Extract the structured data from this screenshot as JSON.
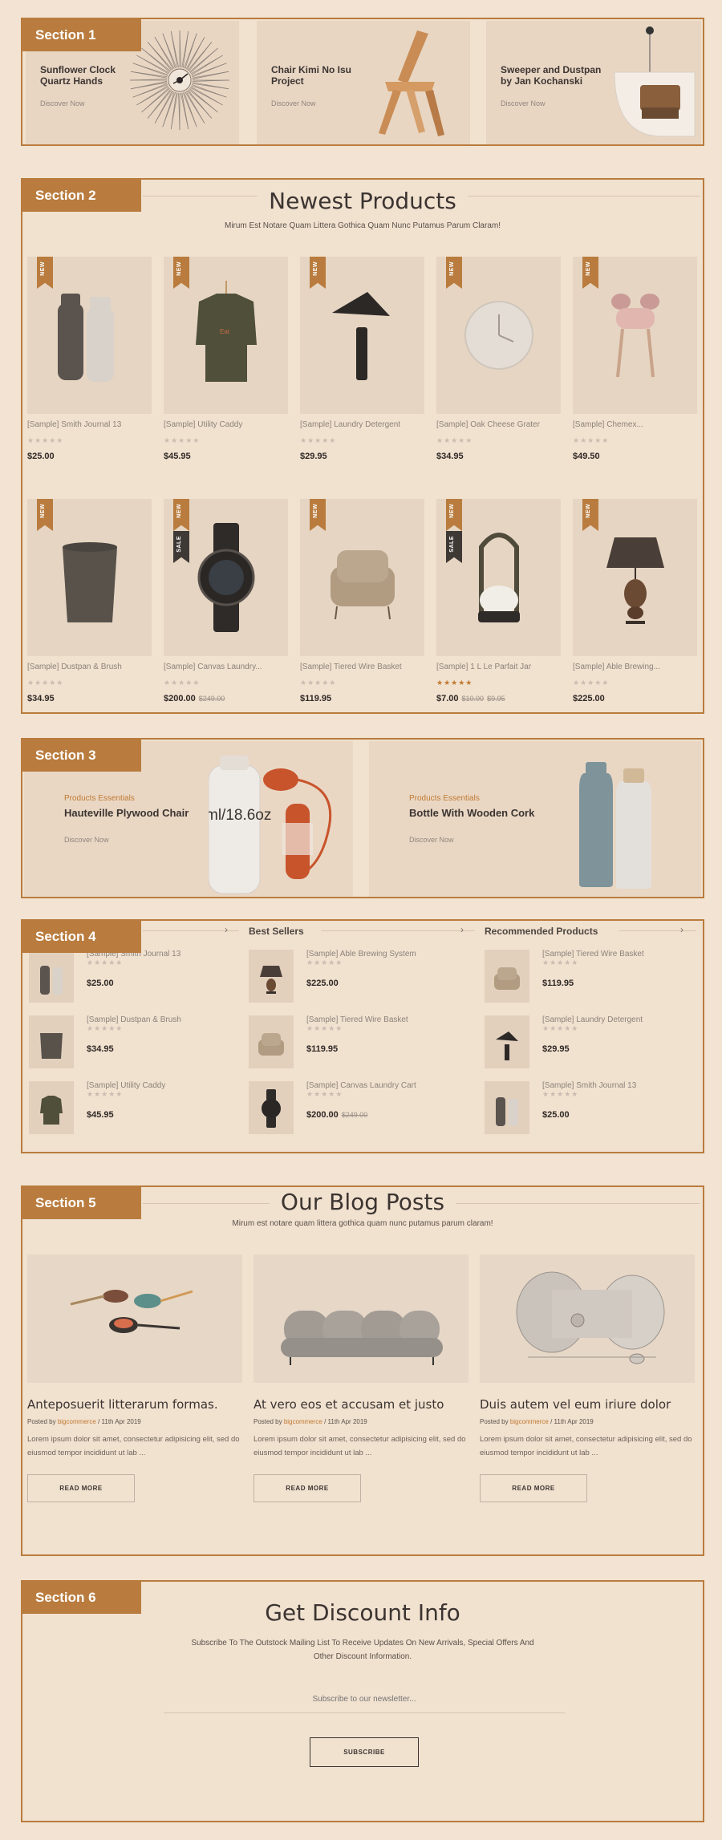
{
  "sections": [
    "Section 1",
    "Section 2",
    "Section 3",
    "Section 4",
    "Section 5",
    "Section 6"
  ],
  "s1": {
    "cards": [
      {
        "title": "Sunflower Clock Quartz Hands",
        "cta": "Discover Now"
      },
      {
        "title": "Chair Kimi No Isu Project",
        "cta": "Discover Now"
      },
      {
        "title": "Sweeper and Dustpan by Jan Kochanski",
        "cta": "Discover Now"
      }
    ]
  },
  "s2": {
    "heading": "Newest Products",
    "subheading": "Mirum Est Notare Quam Littera Gothica Quam Nunc Putamus Parum Claram!",
    "badge_new": "NEW",
    "badge_sale": "SALE",
    "products": [
      {
        "name": "[Sample] Smith Journal 13",
        "stars": "★★★★★",
        "price": "$25.00",
        "old": "",
        "old2": ""
      },
      {
        "name": "[Sample] Utility Caddy",
        "stars": "★★★★★",
        "price": "$45.95",
        "old": "",
        "old2": ""
      },
      {
        "name": "[Sample] Laundry Detergent",
        "stars": "★★★★★",
        "price": "$29.95",
        "old": "",
        "old2": ""
      },
      {
        "name": "[Sample] Oak Cheese Grater",
        "stars": "★★★★★",
        "price": "$34.95",
        "old": "",
        "old2": ""
      },
      {
        "name": "[Sample] Chemex...",
        "stars": "★★★★★",
        "price": "$49.50",
        "old": "",
        "old2": ""
      },
      {
        "name": "[Sample] Dustpan & Brush",
        "stars": "★★★★★",
        "price": "$34.95",
        "old": "",
        "old2": ""
      },
      {
        "name": "[Sample] Canvas Laundry...",
        "stars": "★★★★★",
        "price": "$200.00",
        "old": "$249.00",
        "old2": ""
      },
      {
        "name": "[Sample] Tiered Wire Basket",
        "stars": "★★★★★",
        "price": "$119.95",
        "old": "",
        "old2": ""
      },
      {
        "name": "[Sample] 1 L Le Parfait Jar",
        "stars": "★★★★★",
        "price": "$7.00",
        "old": "$10.00",
        "old2": "$9.95"
      },
      {
        "name": "[Sample] Able Brewing...",
        "stars": "★★★★★",
        "price": "$225.00",
        "old": "",
        "old2": ""
      }
    ]
  },
  "s3": {
    "cards": [
      {
        "kicker": "Products Essentials",
        "title": "Hauteville Plywood Chair",
        "cta": "Discover Now",
        "bottle_text": "ml/18.6oz"
      },
      {
        "kicker": "Products Essentials",
        "title": "Bottle With Wooden Cork",
        "cta": "Discover Now"
      }
    ]
  },
  "s4": {
    "col2_title": "Best Sellers",
    "col3_title": "Recommended Products",
    "arrow": "›",
    "col1": [
      {
        "name": "[Sample] Smith Journal 13",
        "stars": "★★★★★",
        "price": "$25.00",
        "old": ""
      },
      {
        "name": "[Sample] Dustpan & Brush",
        "stars": "★★★★★",
        "price": "$34.95",
        "old": ""
      },
      {
        "name": "[Sample] Utility Caddy",
        "stars": "★★★★★",
        "price": "$45.95",
        "old": ""
      }
    ],
    "col2": [
      {
        "name": "[Sample] Able Brewing System",
        "stars": "★★★★★",
        "price": "$225.00",
        "old": ""
      },
      {
        "name": "[Sample] Tiered Wire Basket",
        "stars": "★★★★★",
        "price": "$119.95",
        "old": ""
      },
      {
        "name": "[Sample] Canvas Laundry Cart",
        "stars": "★★★★★",
        "price": "$200.00",
        "old": "$249.00"
      }
    ],
    "col3": [
      {
        "name": "[Sample] Tiered Wire Basket",
        "stars": "★★★★★",
        "price": "$119.95",
        "old": ""
      },
      {
        "name": "[Sample] Laundry Detergent",
        "stars": "★★★★★",
        "price": "$29.95",
        "old": ""
      },
      {
        "name": "[Sample] Smith Journal 13",
        "stars": "★★★★★",
        "price": "$25.00",
        "old": ""
      }
    ]
  },
  "s5": {
    "heading": "Our Blog Posts",
    "subheading": "Mirum est notare quam littera gothica quam nunc putamus parum claram!",
    "posts": [
      {
        "title": "Anteposuerit litterarum formas.",
        "posted_by": "Posted by",
        "author": "bigcommerce",
        "date": "/ 11th Apr 2019",
        "excerpt": "Lorem ipsum dolor sit amet, consectetur adipisicing elit, sed do eiusmod tempor incididunt ut lab ...",
        "button": "READ MORE"
      },
      {
        "title": "At vero eos et accusam et justo",
        "posted_by": "Posted by",
        "author": "bigcommerce",
        "date": "/ 11th Apr 2019",
        "excerpt": "Lorem ipsum dolor sit amet, consectetur adipisicing elit, sed do eiusmod tempor incididunt ut lab ...",
        "button": "READ MORE"
      },
      {
        "title": "Duis autem vel eum iriure dolor",
        "posted_by": "Posted by",
        "author": "bigcommerce",
        "date": "/ 11th Apr 2019",
        "excerpt": "Lorem ipsum dolor sit amet, consectetur adipisicing elit, sed do eiusmod tempor incididunt ut lab ...",
        "button": "READ MORE"
      }
    ]
  },
  "s6": {
    "heading": "Get Discount Info",
    "subheading_line1": "Subscribe To The Outstock Mailing List To Receive Updates On New Arrivals, Special Offers And",
    "subheading_line2": "Other Discount Information.",
    "placeholder": "Subscribe to our newsletter...",
    "button": "SUBSCRIBE"
  }
}
